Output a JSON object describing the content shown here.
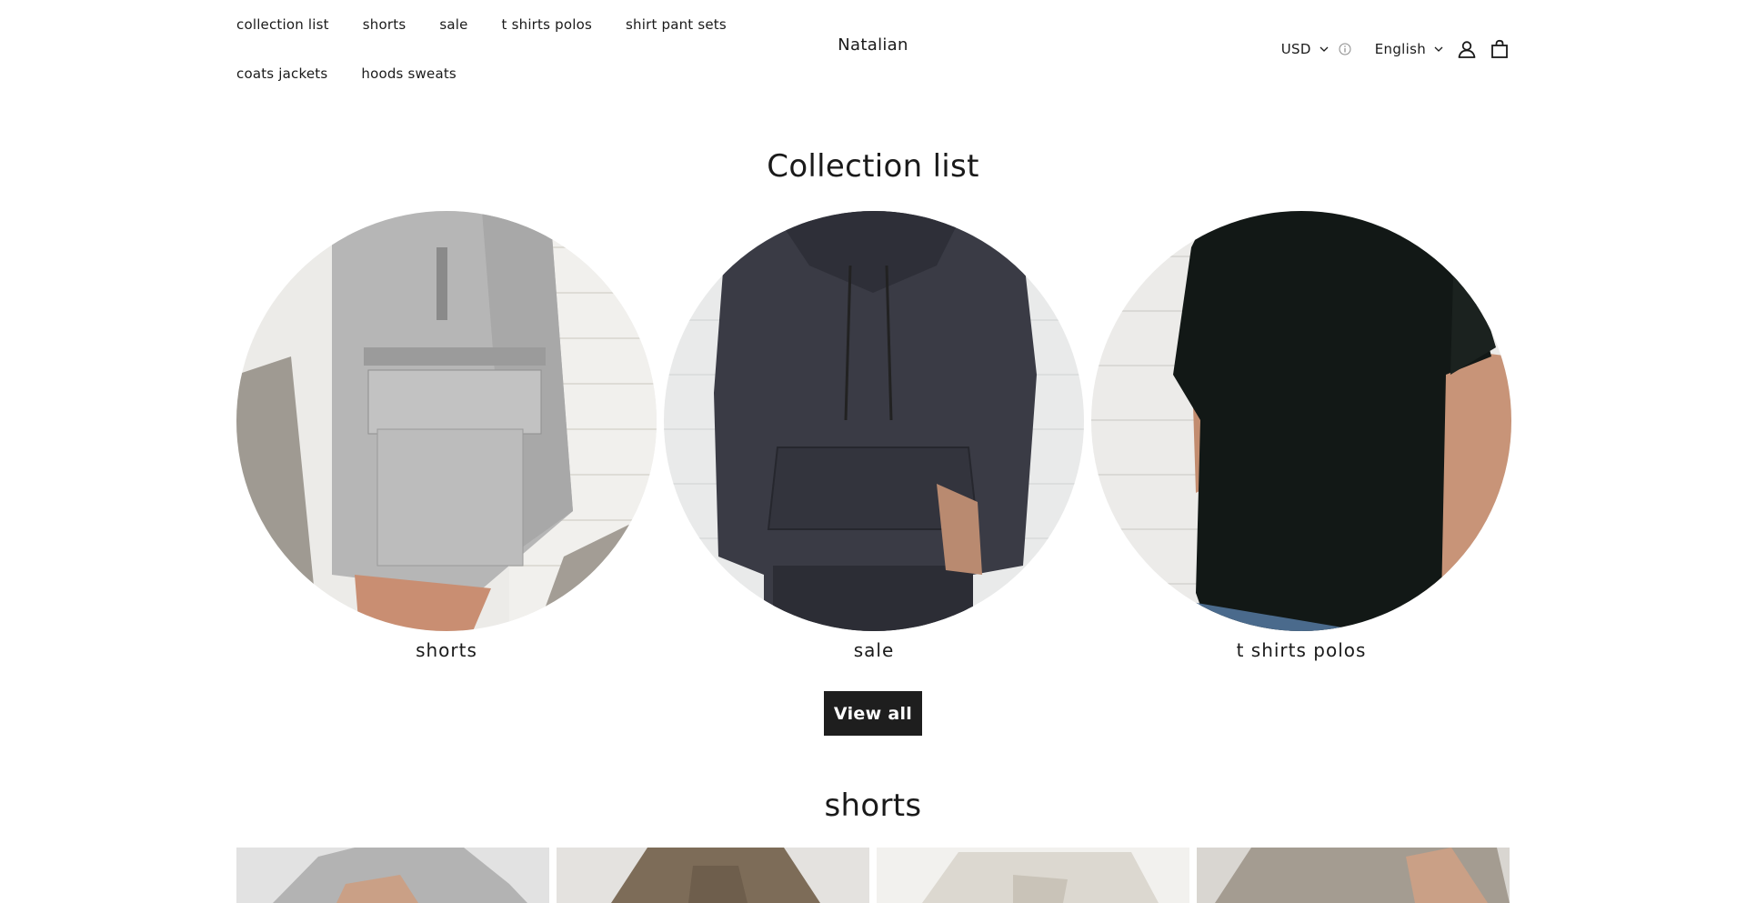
{
  "header": {
    "brand": "Natalian",
    "nav_row1": [
      "collection list",
      "shorts",
      "sale",
      "t shirts polos",
      "shirt pant sets"
    ],
    "nav_row2": [
      "coats jackets",
      "hoods sweats"
    ],
    "currency": "USD",
    "language": "English",
    "icons": [
      "chevron-down-icon",
      "info-icon",
      "account-icon",
      "cart-icon"
    ]
  },
  "collection": {
    "title": "Collection list",
    "items": [
      {
        "label": "shorts",
        "image": "grey cargo shorts"
      },
      {
        "label": "sale",
        "image": "charcoal hoodie"
      },
      {
        "label": "t shirts polos",
        "image": "black t-shirt"
      }
    ],
    "view_all": "View all"
  },
  "shorts_section": {
    "title": "shorts",
    "products": [
      "grey shorts",
      "olive shorts",
      "cream shorts",
      "taupe shorts"
    ]
  },
  "colors": {
    "text": "#1a1a1a",
    "button_bg": "#1e1e1e",
    "button_text": "#ffffff"
  }
}
